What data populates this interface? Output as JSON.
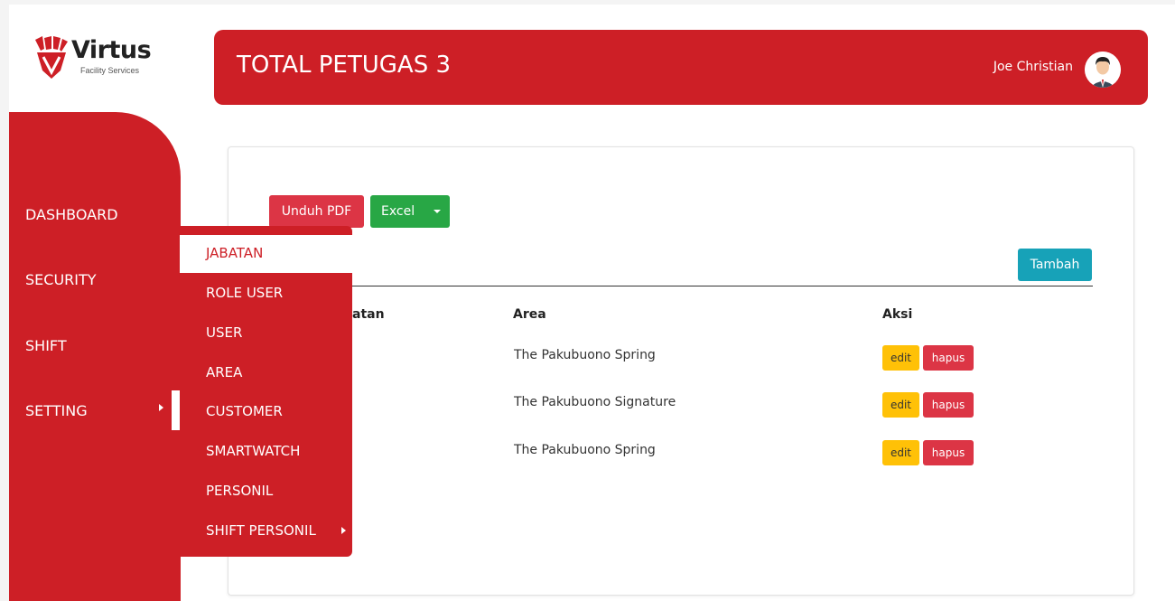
{
  "logo": {
    "brand": "Virtus",
    "tagline": "Facility Services"
  },
  "header": {
    "title": "TOTAL PETUGAS 3",
    "user_name": "Joe Christian"
  },
  "sidebar": {
    "items": [
      {
        "label": "DASHBOARD"
      },
      {
        "label": "SECURITY"
      },
      {
        "label": "SHIFT"
      },
      {
        "label": "SETTING"
      }
    ]
  },
  "submenu": {
    "items": [
      {
        "label": "JABATAN"
      },
      {
        "label": "ROLE USER"
      },
      {
        "label": "USER"
      },
      {
        "label": "AREA"
      },
      {
        "label": "CUSTOMER"
      },
      {
        "label": "SMARTWATCH"
      },
      {
        "label": "PERSONIL"
      },
      {
        "label": "SHIFT PERSONIL"
      }
    ]
  },
  "toolbar": {
    "pdf_label": "Unduh PDF",
    "excel_label": "Excel",
    "add_label": "Tambah"
  },
  "table": {
    "headers": [
      "atan",
      "Area",
      "Aksi"
    ],
    "rows": [
      {
        "area": "The Pakubuono Spring",
        "edit": "edit",
        "delete": "hapus"
      },
      {
        "area": "The Pakubuono Signature",
        "edit": "edit",
        "delete": "hapus"
      },
      {
        "area": "The Pakubuono Spring",
        "edit": "edit",
        "delete": "hapus"
      }
    ]
  },
  "colors": {
    "brand_red": "#cd1f26",
    "pdf_button": "#dc3545",
    "excel_button": "#28a745",
    "add_button": "#17a2b8",
    "edit_button": "#ffc107",
    "delete_button": "#dc3545"
  }
}
